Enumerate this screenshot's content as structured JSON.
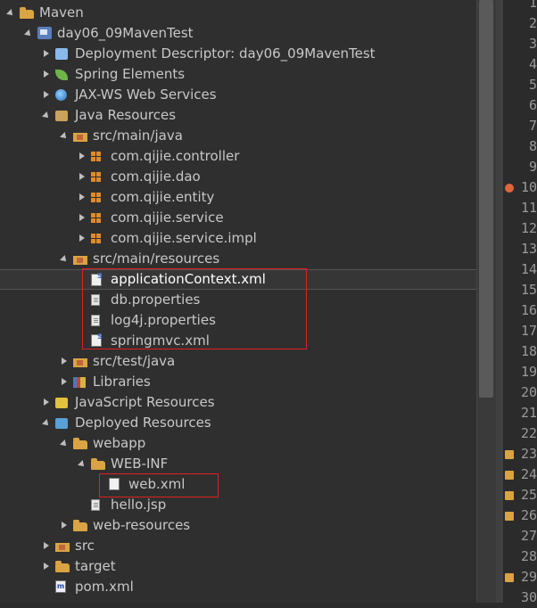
{
  "tree": {
    "rows": [
      {
        "label": "Maven",
        "indent": 0,
        "toggle": "expanded",
        "icon": "folder-icon"
      },
      {
        "label": "day06_09MavenTest",
        "indent": 1,
        "toggle": "expanded",
        "icon": "project-icon"
      },
      {
        "label": "Deployment Descriptor: day06_09MavenTest",
        "indent": 2,
        "toggle": "collapsed",
        "icon": "deployment-descriptor-icon"
      },
      {
        "label": "Spring Elements",
        "indent": 2,
        "toggle": "collapsed",
        "icon": "spring-leaf-icon"
      },
      {
        "label": "JAX-WS Web Services",
        "indent": 2,
        "toggle": "collapsed",
        "icon": "globe-icon"
      },
      {
        "label": "Java Resources",
        "indent": 2,
        "toggle": "expanded",
        "icon": "java-resources-icon"
      },
      {
        "label": "src/main/java",
        "indent": 3,
        "toggle": "expanded",
        "icon": "source-folder-icon"
      },
      {
        "label": "com.qijie.controller",
        "indent": 4,
        "toggle": "collapsed",
        "icon": "package-icon"
      },
      {
        "label": "com.qijie.dao",
        "indent": 4,
        "toggle": "collapsed",
        "icon": "package-icon"
      },
      {
        "label": "com.qijie.entity",
        "indent": 4,
        "toggle": "collapsed",
        "icon": "package-icon"
      },
      {
        "label": "com.qijie.service",
        "indent": 4,
        "toggle": "collapsed",
        "icon": "package-icon"
      },
      {
        "label": "com.qijie.service.impl",
        "indent": 4,
        "toggle": "collapsed",
        "icon": "package-icon"
      },
      {
        "label": "src/main/resources",
        "indent": 3,
        "toggle": "expanded",
        "icon": "source-folder-icon"
      },
      {
        "label": "applicationContext.xml",
        "indent": 4,
        "toggle": "none",
        "icon": "spring-xml-icon",
        "selected": true
      },
      {
        "label": "db.properties",
        "indent": 4,
        "toggle": "none",
        "icon": "properties-file-icon"
      },
      {
        "label": "log4j.properties",
        "indent": 4,
        "toggle": "none",
        "icon": "properties-file-icon"
      },
      {
        "label": "springmvc.xml",
        "indent": 4,
        "toggle": "none",
        "icon": "spring-xml-icon"
      },
      {
        "label": "src/test/java",
        "indent": 3,
        "toggle": "collapsed",
        "icon": "source-folder-icon"
      },
      {
        "label": "Libraries",
        "indent": 3,
        "toggle": "collapsed",
        "icon": "libraries-icon"
      },
      {
        "label": "JavaScript Resources",
        "indent": 2,
        "toggle": "collapsed",
        "icon": "javascript-resources-icon"
      },
      {
        "label": "Deployed Resources",
        "indent": 2,
        "toggle": "expanded",
        "icon": "deployed-resources-icon"
      },
      {
        "label": "webapp",
        "indent": 3,
        "toggle": "expanded",
        "icon": "folder-icon"
      },
      {
        "label": "WEB-INF",
        "indent": 4,
        "toggle": "expanded",
        "icon": "folder-icon"
      },
      {
        "label": "web.xml",
        "indent": 5,
        "toggle": "none",
        "icon": "xml-file-icon"
      },
      {
        "label": "hello.jsp",
        "indent": 4,
        "toggle": "none",
        "icon": "jsp-file-icon"
      },
      {
        "label": "web-resources",
        "indent": 3,
        "toggle": "collapsed",
        "icon": "folder-icon"
      },
      {
        "label": "src",
        "indent": 2,
        "toggle": "collapsed",
        "icon": "source-folder-icon"
      },
      {
        "label": "target",
        "indent": 2,
        "toggle": "collapsed",
        "icon": "folder-icon"
      },
      {
        "label": "pom.xml",
        "indent": 2,
        "toggle": "none",
        "icon": "pom-file-icon"
      }
    ]
  },
  "gutter": {
    "line_numbers": [
      "1",
      "2",
      "3",
      "4",
      "5",
      "6",
      "7",
      "8",
      "9",
      "10",
      "11",
      "12",
      "13",
      "14",
      "15",
      "16",
      "17",
      "18",
      "19",
      "20",
      "21",
      "22",
      "23",
      "24",
      "25",
      "26",
      "27",
      "28",
      "29",
      "30"
    ],
    "markers": {
      "10": "breakpoint-marker-icon",
      "23": "annotation-marker-icon",
      "24": "annotation-marker-icon",
      "25": "annotation-marker-icon",
      "26": "annotation-marker-icon",
      "29": "annotation-marker-icon"
    }
  },
  "colors": {
    "tree_background": "#2f2f2f",
    "text": "#c8c8c8",
    "highlight_box": "#e02020"
  }
}
